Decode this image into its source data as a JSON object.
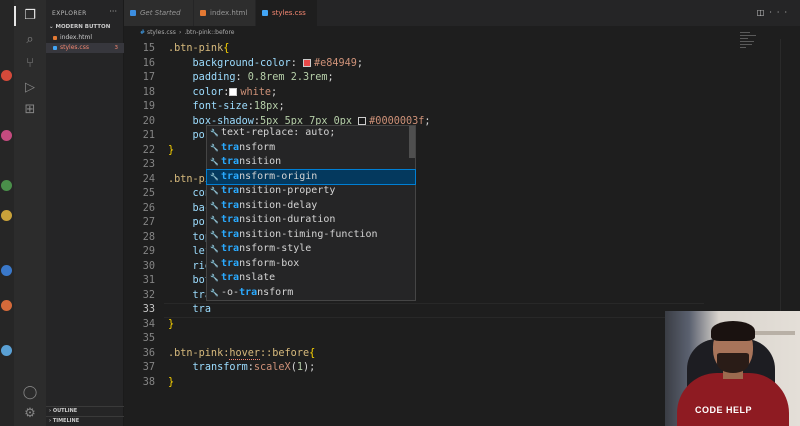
{
  "explorer": {
    "title": "EXPLORER",
    "folder": "MODERN BUTTON",
    "files": [
      {
        "name": "index.html",
        "color": "#e37933",
        "active": false,
        "badge": ""
      },
      {
        "name": "styles.css",
        "color": "#42a5f5",
        "active": true,
        "badge": "3"
      }
    ],
    "sections": [
      "OUTLINE",
      "TIMELINE"
    ]
  },
  "tabs": [
    {
      "label": "Get Started",
      "icon_color": "#3c8ee0",
      "active": false
    },
    {
      "label": "index.html",
      "icon_color": "#e37933",
      "active": false
    },
    {
      "label": "styles.css 3",
      "icon_color": "#42a5f5",
      "active": true
    }
  ],
  "breadcrumb": [
    "styles.css",
    ".btn-pink::before"
  ],
  "editor": {
    "lines": [
      {
        "n": "15",
        "parts": [
          [
            "sel",
            ".btn-pink"
          ],
          [
            "brace",
            "{"
          ]
        ]
      },
      {
        "n": "16",
        "parts": [
          [
            "sp",
            "    "
          ],
          [
            "prop",
            "background-color"
          ],
          [
            "punc",
            ": "
          ],
          [
            "swatch",
            "#e84949"
          ],
          [
            "val",
            "#e84949"
          ],
          [
            "punc",
            ";"
          ]
        ]
      },
      {
        "n": "17",
        "parts": [
          [
            "sp",
            "    "
          ],
          [
            "prop",
            "padding"
          ],
          [
            "punc",
            ": "
          ],
          [
            "num",
            "0.8rem 2.3rem"
          ],
          [
            "punc",
            ";"
          ]
        ]
      },
      {
        "n": "18",
        "parts": [
          [
            "sp",
            "    "
          ],
          [
            "prop",
            "color"
          ],
          [
            "punc",
            ":"
          ],
          [
            "swatch",
            "#ffffff"
          ],
          [
            "val",
            "white"
          ],
          [
            "punc",
            ";"
          ]
        ]
      },
      {
        "n": "19",
        "parts": [
          [
            "sp",
            "    "
          ],
          [
            "prop",
            "font-size"
          ],
          [
            "punc",
            ":"
          ],
          [
            "num",
            "18px"
          ],
          [
            "punc",
            ";"
          ]
        ]
      },
      {
        "n": "20",
        "parts": [
          [
            "sp",
            "    "
          ],
          [
            "prop",
            "box-shadow"
          ],
          [
            "punc",
            ":"
          ],
          [
            "num",
            "5px 5px 7px 0px "
          ],
          [
            "swatch",
            "#0000003f"
          ],
          [
            "val",
            "#0000003f"
          ],
          [
            "punc",
            ";"
          ]
        ]
      },
      {
        "n": "21",
        "parts": [
          [
            "sp",
            "    "
          ],
          [
            "prop",
            "pos"
          ]
        ]
      },
      {
        "n": "22",
        "parts": [
          [
            "brace",
            "}"
          ]
        ]
      },
      {
        "n": "23",
        "parts": []
      },
      {
        "n": "24",
        "parts": [
          [
            "sel",
            ".btn-pi"
          ]
        ]
      },
      {
        "n": "25",
        "parts": [
          [
            "sp",
            "    "
          ],
          [
            "prop",
            "con"
          ]
        ]
      },
      {
        "n": "26",
        "parts": [
          [
            "sp",
            "    "
          ],
          [
            "prop",
            "bac"
          ]
        ]
      },
      {
        "n": "27",
        "parts": [
          [
            "sp",
            "    "
          ],
          [
            "prop",
            "pos"
          ]
        ]
      },
      {
        "n": "28",
        "parts": [
          [
            "sp",
            "    "
          ],
          [
            "prop",
            "top"
          ]
        ]
      },
      {
        "n": "29",
        "parts": [
          [
            "sp",
            "    "
          ],
          [
            "prop",
            "lef"
          ]
        ]
      },
      {
        "n": "30",
        "parts": [
          [
            "sp",
            "    "
          ],
          [
            "prop",
            "rig"
          ]
        ]
      },
      {
        "n": "31",
        "parts": [
          [
            "sp",
            "    "
          ],
          [
            "prop",
            "bot"
          ]
        ]
      },
      {
        "n": "32",
        "parts": [
          [
            "sp",
            "    "
          ],
          [
            "prop",
            "tra"
          ]
        ]
      },
      {
        "n": "33",
        "parts": [
          [
            "sp",
            "    "
          ],
          [
            "prop",
            "tra"
          ]
        ]
      },
      {
        "n": "34",
        "parts": [
          [
            "brace",
            "}"
          ]
        ]
      },
      {
        "n": "35",
        "parts": []
      },
      {
        "n": "36",
        "parts": [
          [
            "sel",
            ".btn-pink:"
          ],
          [
            "hover",
            "hover"
          ],
          [
            "sel",
            "::before"
          ],
          [
            "brace",
            "{"
          ]
        ]
      },
      {
        "n": "37",
        "parts": [
          [
            "sp",
            "    "
          ],
          [
            "prop",
            "transform"
          ],
          [
            "punc",
            ":"
          ],
          [
            "val",
            "scaleX"
          ],
          [
            "punc",
            "("
          ],
          [
            "num",
            "1"
          ],
          [
            "punc",
            ");"
          ]
        ]
      },
      {
        "n": "38",
        "parts": [
          [
            "brace",
            "}"
          ]
        ]
      }
    ],
    "current_line": "33"
  },
  "suggestions": [
    {
      "pre": "text-re",
      "hl": "",
      "post": "place: auto;",
      "full": "text-replace: auto;",
      "selected": false
    },
    {
      "pre": "",
      "hl": "tra",
      "post": "nsform",
      "selected": false
    },
    {
      "pre": "",
      "hl": "tra",
      "post": "nsition",
      "selected": false
    },
    {
      "pre": "",
      "hl": "tra",
      "post": "nsform-origin",
      "selected": true
    },
    {
      "pre": "",
      "hl": "tra",
      "post": "nsition-property",
      "selected": false
    },
    {
      "pre": "",
      "hl": "tra",
      "post": "nsition-delay",
      "selected": false
    },
    {
      "pre": "",
      "hl": "tra",
      "post": "nsition-duration",
      "selected": false
    },
    {
      "pre": "",
      "hl": "tra",
      "post": "nsition-timing-function",
      "selected": false
    },
    {
      "pre": "",
      "hl": "tra",
      "post": "nsform-style",
      "selected": false
    },
    {
      "pre": "",
      "hl": "tra",
      "post": "nsform-box",
      "selected": false
    },
    {
      "pre": "",
      "hl": "tra",
      "post": "nslate",
      "selected": false
    },
    {
      "pre": "-o-",
      "hl": "tra",
      "post": "nsform",
      "selected": false
    }
  ],
  "webcam": {
    "shirt_text": "CODE HELP"
  }
}
